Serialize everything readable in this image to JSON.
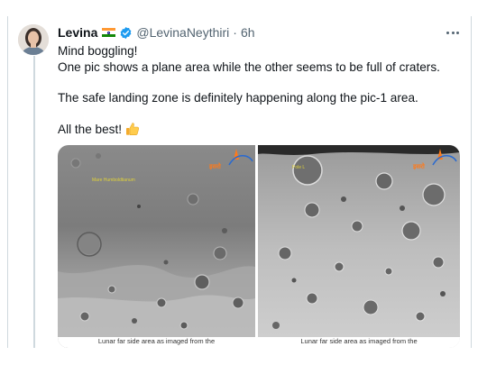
{
  "tweet": {
    "author_name": "Levina",
    "author_flag": "india-flag-icon",
    "author_verified": true,
    "handle": "@LevinaNeythiri",
    "separator": "·",
    "time": "6h",
    "text_lines": [
      "Mind boggling!",
      "One pic shows a plane area while the other seems to be full of craters.",
      "The safe landing zone is definitely happening along the pic-1 area.",
      "All the best!"
    ],
    "emoji": "thumbs-up-emoji"
  },
  "media": {
    "left_image": {
      "label": "Mare Humboldtianum",
      "logo_text": "इसरो",
      "caption": "Lunar far side area as imaged from the"
    },
    "right_image": {
      "label": "Pole L",
      "logo_text": "इसरो",
      "caption": "Lunar far side area as imaged from the"
    }
  },
  "colors": {
    "text": "#0f1419",
    "secondary_text": "#536471",
    "verified_blue": "#1d9bf0",
    "label_yellow": "#e0d23a",
    "isro_orange": "#ff7a1a"
  }
}
